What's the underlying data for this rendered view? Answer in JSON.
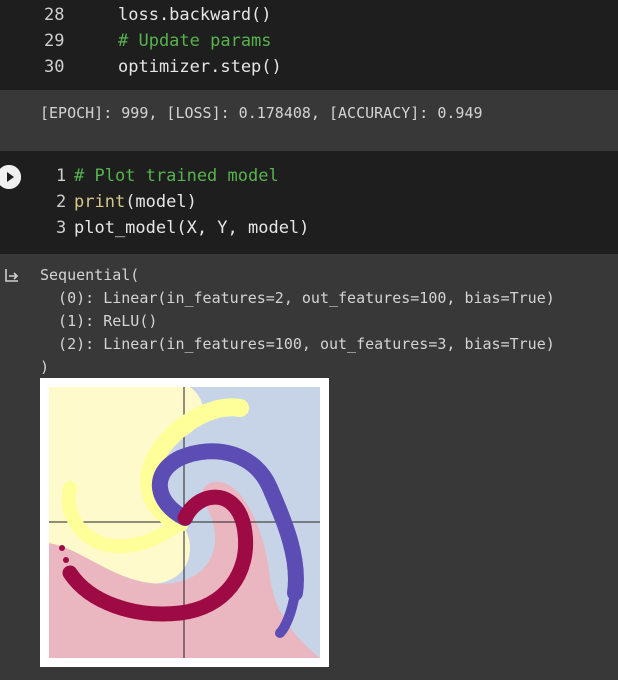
{
  "cell1": {
    "lines": [
      {
        "num": "28",
        "code": "loss.backward()"
      },
      {
        "num": "29",
        "code": "# Update params"
      },
      {
        "num": "30",
        "code": "optimizer.step()"
      }
    ]
  },
  "output1": "[EPOCH]: 999, [LOSS]: 0.178408, [ACCURACY]: 0.949",
  "cell2": {
    "lines": [
      {
        "num": "1",
        "code": "# Plot trained model"
      },
      {
        "num": "2",
        "kw": "print",
        "rest": "(model)"
      },
      {
        "num": "3",
        "code": "plot_model(X, Y, model)"
      }
    ]
  },
  "output2": {
    "lines": [
      "Sequential(",
      "  (0): Linear(in_features=2, out_features=100, bias=True)",
      "  (1): ReLU()",
      "  (2): Linear(in_features=100, out_features=3, bias=True)",
      ")"
    ]
  },
  "icons": {
    "run": "play-icon",
    "output": "output-arrow-icon"
  },
  "colors": {
    "class0": "#9e0a44",
    "class1": "#ffff9a",
    "class2": "#5c4db5",
    "region0": "#eab7c1",
    "region1": "#fffacc",
    "region2": "#c7d4e8"
  }
}
